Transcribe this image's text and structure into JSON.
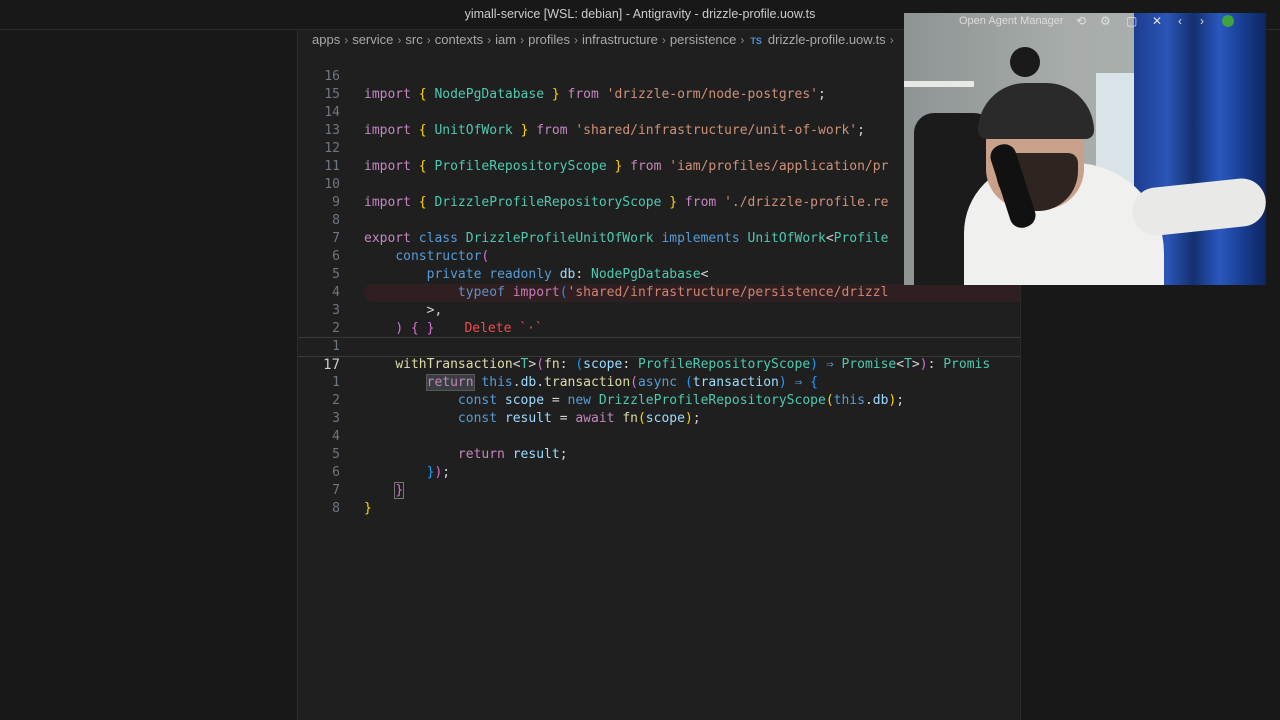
{
  "window": {
    "title": "yimall-service [WSL: debian] - Antigravity - drizzle-profile.uow.ts"
  },
  "breadcrumb": [
    "apps",
    "service",
    "src",
    "contexts",
    "iam",
    "profiles",
    "infrastructure",
    "persistence"
  ],
  "breadcrumb_file": {
    "lang": "TS",
    "name": "drizzle-profile.uow.ts"
  },
  "overlay": {
    "agent_manager": "Open Agent Manager"
  },
  "line_numbers": [
    "16",
    "15",
    "14",
    "13",
    "12",
    "11",
    "10",
    "9",
    "8",
    "7",
    "6",
    "5",
    "4",
    "3",
    "2",
    "1",
    "17",
    "1",
    "2",
    "3",
    "4",
    "5",
    "6",
    "7",
    "8"
  ],
  "code": {
    "l16": [
      "import",
      "{",
      "NodePgDatabase",
      "}",
      "from",
      "'drizzle-orm/node-postgres'",
      ";"
    ],
    "l14": [
      "import",
      "{",
      "UnitOfWork",
      "}",
      "from",
      "'shared/infrastructure/unit-of-work'",
      ";"
    ],
    "l12": [
      "import",
      "{",
      "ProfileRepositoryScope",
      "}",
      "from",
      "'iam/profiles/application/pr"
    ],
    "l10": [
      "import",
      "{",
      "DrizzleProfileRepositoryScope",
      "}",
      "from",
      "'./drizzle-profile.re"
    ],
    "l8": [
      "export",
      "class",
      "DrizzleProfileUnitOfWork",
      "implements",
      "UnitOfWork",
      "<",
      "Profile"
    ],
    "l7": [
      "constructor",
      "("
    ],
    "l6": [
      "private",
      "readonly",
      "db",
      ":",
      "NodePgDatabase",
      "<"
    ],
    "l5": [
      "typeof",
      "import",
      "(",
      "'shared/infrastructure/persistence/drizzl"
    ],
    "l4": [
      ">",
      ","
    ],
    "l3": [
      ")",
      "{",
      "}",
      "Delete `·`"
    ],
    "l1": [
      "withTransaction",
      "<",
      "T",
      ">",
      "(",
      "fn",
      ":",
      "(",
      "scope",
      ":",
      "ProfileRepositoryScope",
      ")",
      "⇒",
      "Promise",
      "<",
      "T",
      ">",
      ")",
      ":",
      "Promis"
    ],
    "l17": [
      "return",
      "this",
      ".",
      "db",
      ".",
      "transaction",
      "(",
      "async",
      "(",
      "transaction",
      ")",
      "⇒",
      "{"
    ],
    "a1": [
      "const",
      "scope",
      "=",
      "new",
      "DrizzleProfileRepositoryScope",
      "(",
      "this",
      ".",
      "db",
      ")",
      ";"
    ],
    "a2": [
      "const",
      "result",
      "=",
      "await",
      "fn",
      "(",
      "scope",
      ")",
      ";"
    ],
    "a4": [
      "return",
      "result",
      ";"
    ],
    "a5": [
      "}",
      ")",
      ";"
    ],
    "a6": [
      "}"
    ],
    "a7": [
      "}"
    ]
  },
  "colors": {
    "keyword": "#c586c0",
    "storage": "#569cd6",
    "type": "#4ec9b0",
    "function": "#dcdcaa",
    "variable": "#9cdcfe",
    "string": "#ce9178",
    "bracket1": "#ffd700",
    "bracket2": "#da70d6",
    "bracket3": "#179fff",
    "error": "#f14c4c"
  }
}
